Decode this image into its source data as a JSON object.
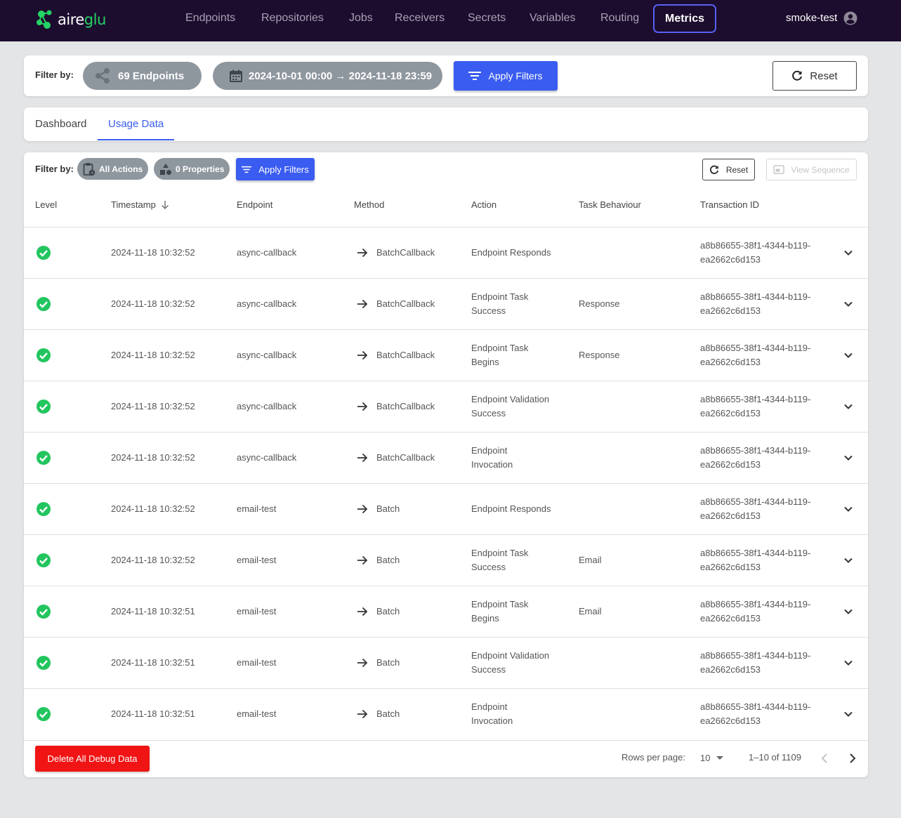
{
  "nav": {
    "logo_prefix": "aire",
    "logo_suffix": "glu",
    "items": [
      {
        "label": "Endpoints"
      },
      {
        "label": "Repositories"
      },
      {
        "label": "Jobs"
      },
      {
        "label": "Receivers"
      },
      {
        "label": "Secrets"
      },
      {
        "label": "Variables"
      },
      {
        "label": "Routing"
      },
      {
        "label": "Metrics"
      }
    ],
    "active": "Metrics",
    "user": "smoke-test"
  },
  "global_filter": {
    "label": "Filter by:",
    "endpoints_pill": "69 Endpoints",
    "date_pill": "2024-10-01 00:00 → 2024-11-18 23:59",
    "apply_label": "Apply Filters",
    "reset_label": "Reset"
  },
  "tabs": [
    {
      "label": "Dashboard"
    },
    {
      "label": "Usage Data"
    }
  ],
  "active_tab": "Usage Data",
  "usage_filter": {
    "label": "Filter by:",
    "actions_pill": "All Actions",
    "properties_pill": "0 Properties",
    "apply_label": "Apply Filters",
    "reset_label": "Reset",
    "view_sequence_label": "View Sequence"
  },
  "table": {
    "columns": [
      "Level",
      "Timestamp",
      "Endpoint",
      "Method",
      "Action",
      "Task Behaviour",
      "Transaction ID"
    ],
    "sort_column": "Timestamp",
    "sort_direction": "descending",
    "rows": [
      {
        "level": "success",
        "timestamp": "2024-11-18 10:32:52",
        "endpoint": "async-callback",
        "method": "BatchCallback",
        "action_l1": "Endpoint Responds",
        "action_l2": "",
        "task_behaviour": "",
        "txn_l1": "a8b86655-38f1-4344-b119-",
        "txn_l2": "ea2662c6d153"
      },
      {
        "level": "success",
        "timestamp": "2024-11-18 10:32:52",
        "endpoint": "async-callback",
        "method": "BatchCallback",
        "action_l1": "Endpoint Task",
        "action_l2": "Success",
        "task_behaviour": "Response",
        "txn_l1": "a8b86655-38f1-4344-b119-",
        "txn_l2": "ea2662c6d153"
      },
      {
        "level": "success",
        "timestamp": "2024-11-18 10:32:52",
        "endpoint": "async-callback",
        "method": "BatchCallback",
        "action_l1": "Endpoint Task",
        "action_l2": "Begins",
        "task_behaviour": "Response",
        "txn_l1": "a8b86655-38f1-4344-b119-",
        "txn_l2": "ea2662c6d153"
      },
      {
        "level": "success",
        "timestamp": "2024-11-18 10:32:52",
        "endpoint": "async-callback",
        "method": "BatchCallback",
        "action_l1": "Endpoint Validation",
        "action_l2": "Success",
        "task_behaviour": "",
        "txn_l1": "a8b86655-38f1-4344-b119-",
        "txn_l2": "ea2662c6d153"
      },
      {
        "level": "success",
        "timestamp": "2024-11-18 10:32:52",
        "endpoint": "async-callback",
        "method": "BatchCallback",
        "action_l1": "Endpoint",
        "action_l2": "Invocation",
        "task_behaviour": "",
        "txn_l1": "a8b86655-38f1-4344-b119-",
        "txn_l2": "ea2662c6d153"
      },
      {
        "level": "success",
        "timestamp": "2024-11-18 10:32:52",
        "endpoint": "email-test",
        "method": "Batch",
        "action_l1": "Endpoint Responds",
        "action_l2": "",
        "task_behaviour": "",
        "txn_l1": "a8b86655-38f1-4344-b119-",
        "txn_l2": "ea2662c6d153"
      },
      {
        "level": "success",
        "timestamp": "2024-11-18 10:32:52",
        "endpoint": "email-test",
        "method": "Batch",
        "action_l1": "Endpoint Task",
        "action_l2": "Success",
        "task_behaviour": "Email",
        "txn_l1": "a8b86655-38f1-4344-b119-",
        "txn_l2": "ea2662c6d153"
      },
      {
        "level": "success",
        "timestamp": "2024-11-18 10:32:51",
        "endpoint": "email-test",
        "method": "Batch",
        "action_l1": "Endpoint Task",
        "action_l2": "Begins",
        "task_behaviour": "Email",
        "txn_l1": "a8b86655-38f1-4344-b119-",
        "txn_l2": "ea2662c6d153"
      },
      {
        "level": "success",
        "timestamp": "2024-11-18 10:32:51",
        "endpoint": "email-test",
        "method": "Batch",
        "action_l1": "Endpoint Validation",
        "action_l2": "Success",
        "task_behaviour": "",
        "txn_l1": "a8b86655-38f1-4344-b119-",
        "txn_l2": "ea2662c6d153"
      },
      {
        "level": "success",
        "timestamp": "2024-11-18 10:32:51",
        "endpoint": "email-test",
        "method": "Batch",
        "action_l1": "Endpoint",
        "action_l2": "Invocation",
        "task_behaviour": "",
        "txn_l1": "a8b86655-38f1-4344-b119-",
        "txn_l2": "ea2662c6d153"
      }
    ]
  },
  "footer": {
    "delete_label": "Delete All Debug Data",
    "rows_per_page_label": "Rows per page:",
    "rows_per_page_value": "10",
    "range_label": "1–10 of 1109"
  },
  "colors": {
    "nav_bg": "#1c0d2e",
    "accent": "#3a5cf0",
    "success": "#22c55e",
    "danger": "#f01414",
    "pill_bg": "#8e969e"
  }
}
